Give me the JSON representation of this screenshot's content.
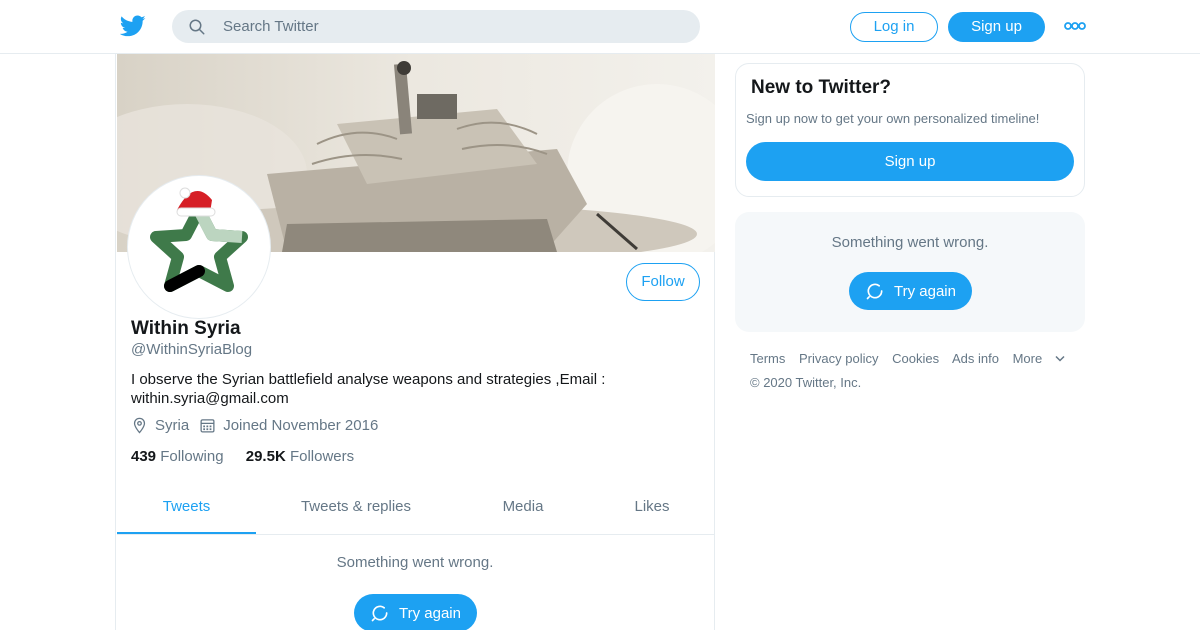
{
  "header": {
    "search_placeholder": "Search Twitter",
    "login_label": "Log in",
    "signup_label": "Sign up"
  },
  "profile": {
    "name": "Within Syria",
    "handle": "@WithinSyriaBlog",
    "bio": "I observe the Syrian battlefield analyse weapons and strategies ,Email : within.syria@gmail.com",
    "location": "Syria",
    "joined": "Joined November 2016",
    "following_count": "439",
    "following_label": "Following",
    "followers_count": "29.5K",
    "followers_label": "Followers",
    "follow_label": "Follow"
  },
  "tabs": [
    {
      "label": "Tweets",
      "active": true
    },
    {
      "label": "Tweets & replies",
      "active": false
    },
    {
      "label": "Media",
      "active": false
    },
    {
      "label": "Likes",
      "active": false
    }
  ],
  "timeline": {
    "error_text": "Something went wrong.",
    "try_again_label": "Try again"
  },
  "sidebar": {
    "new_title": "New to Twitter?",
    "new_subtitle": "Sign up now to get your own personalized timeline!",
    "signup_label": "Sign up",
    "error_text": "Something went wrong.",
    "try_again_label": "Try again"
  },
  "footer": {
    "links": [
      "Terms",
      "Privacy policy",
      "Cookies",
      "Ads info",
      "More"
    ],
    "copyright": "© 2020 Twitter, Inc."
  },
  "icons": {
    "logo": "twitter-bird-icon",
    "search": "search-icon",
    "more": "more-dots-icon",
    "location": "location-pin-icon",
    "calendar": "calendar-icon",
    "refresh": "refresh-icon",
    "chevron": "chevron-down-icon"
  },
  "colors": {
    "brand": "#1da1f2",
    "text": "#14171a",
    "muted": "#657786",
    "border": "#e6ecf0",
    "panel": "#f5f8fa"
  }
}
